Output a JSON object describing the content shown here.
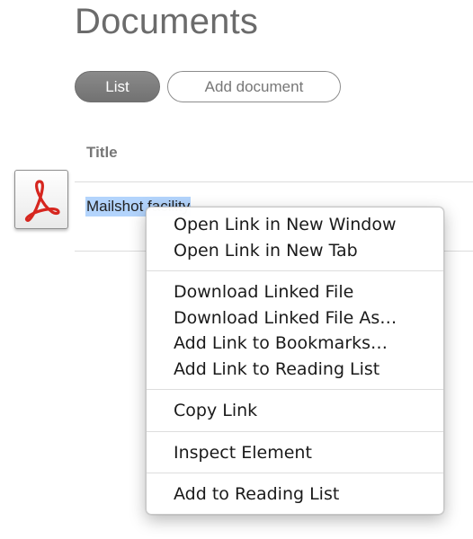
{
  "page": {
    "title": "Documents"
  },
  "toolbar": {
    "list_label": "List",
    "add_document_label": "Add document"
  },
  "table": {
    "column_title": "Title",
    "rows": [
      {
        "title": "Mailshot facility",
        "icon": "pdf-icon",
        "selected": true
      }
    ]
  },
  "context_menu": {
    "groups": [
      [
        "Open Link in New Window",
        "Open Link in New Tab"
      ],
      [
        "Download Linked File",
        "Download Linked File As…",
        "Add Link to Bookmarks…",
        "Add Link to Reading List"
      ],
      [
        "Copy Link"
      ],
      [
        "Inspect Element"
      ],
      [
        "Add to Reading List"
      ]
    ]
  },
  "colors": {
    "selection_highlight": "#b3d4fc",
    "pdf_red": "#d6261f",
    "active_button": "#7d7d7d"
  }
}
